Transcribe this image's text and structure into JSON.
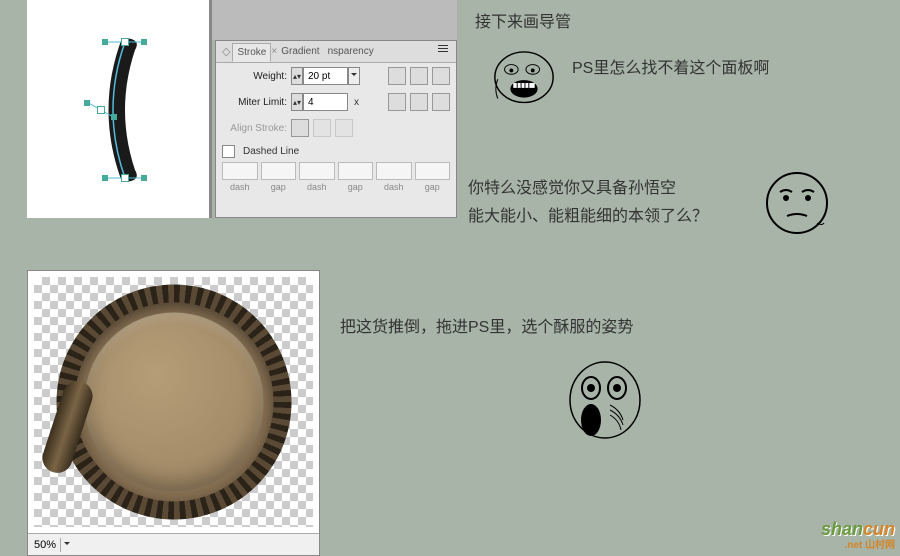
{
  "panel": {
    "tabs": {
      "stroke": "Stroke",
      "gradient": "Gradient",
      "transparency": "nsparency"
    },
    "weight_label": "Weight:",
    "weight_value": "20 pt",
    "miter_label": "Miter Limit:",
    "miter_value": "4",
    "miter_suffix": "x",
    "align_label": "Align Stroke:",
    "dashed_label": "Dashed Line",
    "dash_labels": [
      "dash",
      "gap",
      "dash",
      "gap",
      "dash",
      "gap"
    ]
  },
  "texts": {
    "t1": "接下来画导管",
    "t2": "PS里怎么找不着这个面板啊",
    "t3a": "你特么没感觉你又具备孙悟空",
    "t3b": "能大能小、能粗能细的本领了么？",
    "t4": "把这货推倒，拖进PS里，选个酥服的姿势"
  },
  "zoom": {
    "level": "50%"
  },
  "watermark": {
    "a": "shan",
    "b": "cun",
    "net": ".net 山村网"
  },
  "icons": {
    "cap1": "cap-butt",
    "cap2": "cap-round",
    "cap3": "cap-square",
    "corner1": "corner-miter",
    "corner2": "corner-round",
    "corner3": "corner-bevel",
    "align1": "align-center",
    "align2": "align-inside",
    "align3": "align-outside"
  }
}
